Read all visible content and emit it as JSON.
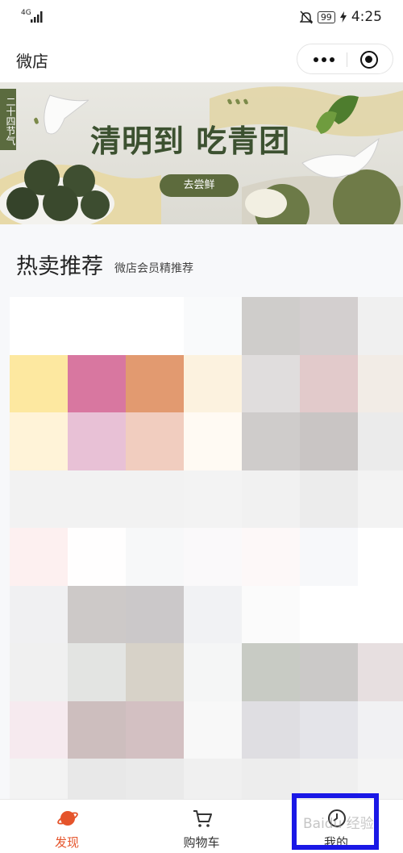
{
  "status_bar": {
    "network": "4G",
    "battery": "99",
    "time": "4:25"
  },
  "nav": {
    "title": "微店"
  },
  "banner": {
    "solar_term_tag": "二十四节气",
    "headline": "清明到 吃青团",
    "button_label": "去尝鲜"
  },
  "section": {
    "title": "热卖推荐",
    "subtitle": "微店会员精推荐"
  },
  "mosaic_colors": [
    "#ffffff",
    "#ffffff",
    "#ffffff",
    "#f9fafb",
    "#cfcdcb",
    "#d3cfcf",
    "#f0f0f0",
    "#fde8a0",
    "#d877a0",
    "#e29a70",
    "#fcf2df",
    "#e0dddd",
    "#e2cacb",
    "#f2ece6",
    "#fff3d8",
    "#e8c1d6",
    "#f1cdbf",
    "#fffaf3",
    "#cfcccb",
    "#c9c5c4",
    "#ebebeb",
    "#f2f2f2",
    "#f2f2f2",
    "#f2f2f2",
    "#f3f3f3",
    "#f1f1f1",
    "#ececec",
    "#f3f3f3",
    "#fdf0f0",
    "#fffefe",
    "#f7f8f9",
    "#faf9fa",
    "#fdf8f8",
    "#f7f8fa",
    "#ffffff",
    "#f0f0f2",
    "#cdc9c8",
    "#cbc8c9",
    "#f1f2f4",
    "#fbfbfb",
    "#ffffff",
    "#ffffff",
    "#f0f0f0",
    "#e3e4e2",
    "#d7d2c8",
    "#f5f6f6",
    "#c8cbc4",
    "#cbc9c8",
    "#e7dfe0",
    "#f6eaef",
    "#cdbebe",
    "#d3c0c2",
    "#f8f8f8",
    "#dfdee2",
    "#e4e4e9",
    "#f1f1f3",
    "#f3f3f3",
    "#e8e8e8",
    "#eaeaea",
    "#f0f0f0",
    "#ededed",
    "#efefef",
    "#f4f4f4"
  ],
  "tabs": [
    {
      "label": "发现",
      "icon": "planet-icon",
      "active": true
    },
    {
      "label": "购物车",
      "icon": "cart-icon",
      "active": false
    },
    {
      "label": "我的",
      "icon": "user-icon",
      "active": false
    }
  ],
  "watermark": "Baidu 经验"
}
